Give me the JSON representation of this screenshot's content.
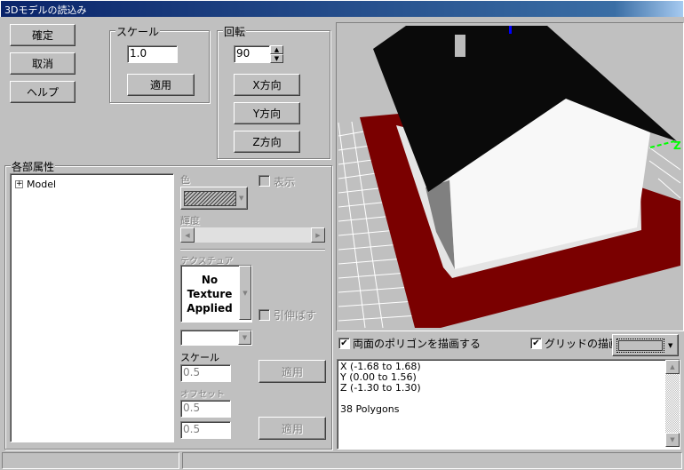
{
  "window": {
    "title": "3Dモデルの読込み"
  },
  "buttons": {
    "ok": "確定",
    "cancel": "取消",
    "help": "ヘルプ"
  },
  "scale_group": {
    "label": "スケール",
    "value": "1.0",
    "apply": "適用"
  },
  "rotate_group": {
    "label": "回転",
    "value": "90",
    "x": "X方向",
    "y": "Y方向",
    "z": "Z方向"
  },
  "parts": {
    "label": "各部属性",
    "tree": [
      {
        "label": "Model",
        "expander": "+"
      }
    ],
    "color_label": "色",
    "show_label": "表示",
    "brightness_label": "輝度",
    "texture_label": "テクスチュア",
    "texture_preview": [
      "No",
      "Texture",
      "Applied"
    ],
    "stretch_label": "引伸ばす",
    "tex_scale_label": "スケール",
    "tex_scale": "0.5",
    "apply1": "適用",
    "offset_label": "オフセット",
    "offset_x": "0.5",
    "offset_y": "0.5",
    "apply2": "適用"
  },
  "viewport": {
    "colors": {
      "floor": "#7a0000",
      "roof": "#0a0a0a",
      "wall": "#ffffff",
      "grid_bg": "#c0c0c0"
    },
    "axis_label": "Z"
  },
  "options": {
    "double_sided": {
      "label": "両面のポリゴンを描画する",
      "checked": true
    },
    "grid": {
      "label": "グリッドの描画",
      "checked": true
    }
  },
  "info": {
    "lines": [
      "X (-1.68 to 1.68)",
      "Y (0.00 to 1.56)",
      "Z (-1.30 to 1.30)",
      "",
      "38 Polygons"
    ]
  }
}
